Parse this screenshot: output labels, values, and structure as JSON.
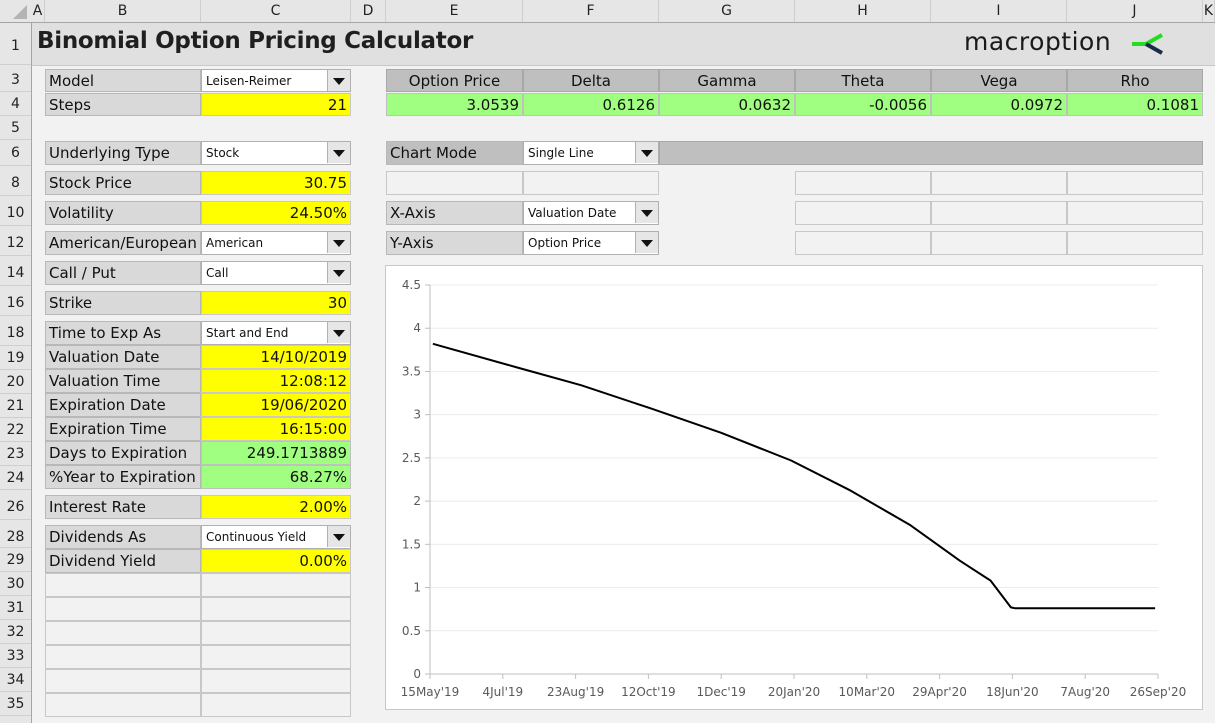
{
  "sheet": {
    "columns": [
      "A",
      "B",
      "C",
      "D",
      "E",
      "F",
      "G",
      "H",
      "I",
      "J",
      "K"
    ],
    "rows": [
      "1",
      "3",
      "4",
      "5",
      "6",
      "8",
      "10",
      "12",
      "14",
      "16",
      "18",
      "19",
      "20",
      "21",
      "22",
      "23",
      "24",
      "26",
      "28",
      "29",
      "30",
      "31",
      "32",
      "33",
      "34",
      "35"
    ]
  },
  "header": {
    "title": "Binomial Option Pricing Calculator",
    "logo_text": "macroption",
    "logo_colors": {
      "green": "#22dd22",
      "navy": "#1b2a4a"
    }
  },
  "inputs": {
    "model": {
      "label": "Model",
      "value": "Leisen-Reimer"
    },
    "steps": {
      "label": "Steps",
      "value": "21"
    },
    "underlying_type": {
      "label": "Underlying Type",
      "value": "Stock"
    },
    "stock_price": {
      "label": "Stock Price",
      "value": "30.75"
    },
    "volatility": {
      "label": "Volatility",
      "value": "24.50%"
    },
    "american_european": {
      "label": "American/European",
      "value": "American"
    },
    "call_put": {
      "label": "Call / Put",
      "value": "Call"
    },
    "strike": {
      "label": "Strike",
      "value": "30"
    },
    "time_to_exp_as": {
      "label": "Time to Exp As",
      "value": "Start and End"
    },
    "valuation_date": {
      "label": "Valuation Date",
      "value": "14/10/2019"
    },
    "valuation_time": {
      "label": "Valuation Time",
      "value": "12:08:12"
    },
    "expiration_date": {
      "label": "Expiration Date",
      "value": "19/06/2020"
    },
    "expiration_time": {
      "label": "Expiration Time",
      "value": "16:15:00"
    },
    "days_to_expiration": {
      "label": "Days to Expiration",
      "value": "249.1713889"
    },
    "year_to_expiration": {
      "label": "%Year to Expiration",
      "value": "68.27%"
    },
    "interest_rate": {
      "label": "Interest Rate",
      "value": "2.00%"
    },
    "dividends_as": {
      "label": "Dividends As",
      "value": "Continuous Yield"
    },
    "dividend_yield": {
      "label": "Dividend Yield",
      "value": "0.00%"
    }
  },
  "results": {
    "headers": [
      "Option Price",
      "Delta",
      "Gamma",
      "Theta",
      "Vega",
      "Rho"
    ],
    "values": [
      "3.0539",
      "0.6126",
      "0.0632",
      "-0.0056",
      "0.0972",
      "0.1081"
    ]
  },
  "chart_settings": {
    "chart_mode": {
      "label": "Chart Mode",
      "value": "Single Line"
    },
    "x_axis": {
      "label": "X-Axis",
      "value": "Valuation Date"
    },
    "y_axis": {
      "label": "Y-Axis",
      "value": "Option Price"
    }
  },
  "colors": {
    "input_yellow": "#ffff00",
    "output_green": "#a0ff80",
    "header_gray": "#bfbfbf",
    "label_gray": "#d9d9d9"
  },
  "chart_data": {
    "type": "line",
    "title": "",
    "xlabel": "",
    "ylabel": "",
    "x_tick_labels": [
      "15May'19",
      "4Jul'19",
      "23Aug'19",
      "12Oct'19",
      "1Dec'19",
      "20Jan'20",
      "10Mar'20",
      "29Apr'20",
      "18Jun'20",
      "7Aug'20",
      "26Sep'20"
    ],
    "x_tick_days": [
      0,
      50,
      100,
      150,
      200,
      250,
      300,
      350,
      400,
      450,
      500
    ],
    "xlim_days": [
      0,
      500
    ],
    "y_ticks": [
      "0",
      "0.5",
      "1",
      "1.5",
      "2",
      "2.5",
      "3",
      "3.5",
      "4",
      "4.5"
    ],
    "ylim": [
      0,
      4.5
    ],
    "grid": true,
    "legend": "none",
    "series": [
      {
        "name": "Option Price",
        "color": "#000000",
        "x_days": [
          2,
          59,
          104,
          152,
          200,
          248,
          289,
          330,
          364,
          385,
          399,
          402,
          498
        ],
        "values": [
          3.82,
          3.55,
          3.34,
          3.07,
          2.79,
          2.47,
          2.12,
          1.72,
          1.31,
          1.08,
          0.77,
          0.76,
          0.76
        ]
      }
    ]
  }
}
